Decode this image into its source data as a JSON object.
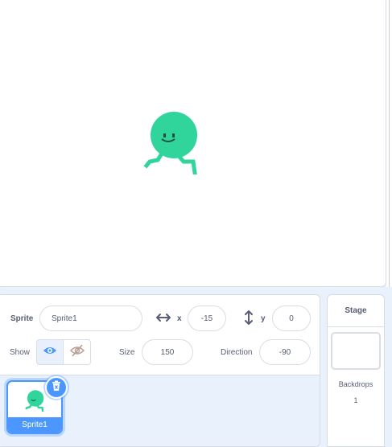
{
  "stage": {
    "sprite_icon": "green-ball-sprite-icon"
  },
  "sprite_info": {
    "sprite_label": "Sprite",
    "sprite_name": "Sprite1",
    "x_label": "x",
    "x_value": "-15",
    "y_label": "y",
    "y_value": "0",
    "show_label": "Show",
    "size_label": "Size",
    "size_value": "150",
    "direction_label": "Direction",
    "direction_value": "-90"
  },
  "sprite_list": {
    "items": [
      {
        "name": "Sprite1",
        "selected": true
      }
    ]
  },
  "stage_panel": {
    "title": "Stage",
    "backdrops_label": "Backdrops",
    "backdrops_count": "1"
  },
  "colors": {
    "accent": "#4c97ff",
    "sprite_green": "#2fd59a",
    "panel_bg": "#e9f1fc",
    "text": "#575e75"
  }
}
